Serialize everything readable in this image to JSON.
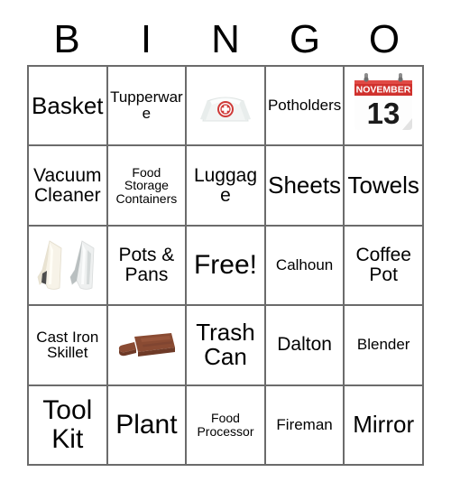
{
  "card": {
    "header_letters": [
      "B",
      "I",
      "N",
      "G",
      "O"
    ],
    "rows": [
      [
        {
          "type": "text",
          "label": "Basket",
          "size": "t-lg"
        },
        {
          "type": "text",
          "label": "Tupperware",
          "size": "t-sm"
        },
        {
          "type": "emoji",
          "label": "nurse-cap",
          "alt": "Nurse cap"
        },
        {
          "type": "text",
          "label": "Potholders",
          "size": "t-sm"
        },
        {
          "type": "emoji",
          "label": "calendar-november-13",
          "alt": "Calendar November 13",
          "calendar": {
            "month": "NOVEMBER",
            "day": "13",
            "header_color": "#d0312d",
            "day_color": "#1a1a1a"
          }
        }
      ],
      [
        {
          "type": "text",
          "label": "Vacuum Cleaner",
          "size": "t-md"
        },
        {
          "type": "text",
          "label": "Food Storage Containers",
          "size": "t-xs"
        },
        {
          "type": "text",
          "label": "Luggage",
          "size": "t-md"
        },
        {
          "type": "text",
          "label": "Sheets",
          "size": "t-lg"
        },
        {
          "type": "text",
          "label": "Towels",
          "size": "t-lg"
        }
      ],
      [
        {
          "type": "emoji",
          "label": "two-hanging-towels",
          "alt": "Two hanging towels"
        },
        {
          "type": "text",
          "label": "Pots & Pans",
          "size": "t-md"
        },
        {
          "type": "text",
          "label": "Free!",
          "size": "t-xl"
        },
        {
          "type": "text",
          "label": "Calhoun",
          "size": "t-sm"
        },
        {
          "type": "text",
          "label": "Coffee Pot",
          "size": "t-md"
        }
      ],
      [
        {
          "type": "text",
          "label": "Cast Iron Skillet",
          "size": "t-sm"
        },
        {
          "type": "emoji",
          "label": "wooden-cutting-board",
          "alt": "Wooden cutting board"
        },
        {
          "type": "text",
          "label": "Trash Can",
          "size": "t-lg"
        },
        {
          "type": "text",
          "label": "Dalton",
          "size": "t-md"
        },
        {
          "type": "text",
          "label": "Blender",
          "size": "t-sm"
        }
      ],
      [
        {
          "type": "text",
          "label": "Tool Kit",
          "size": "t-xl"
        },
        {
          "type": "text",
          "label": "Plant",
          "size": "t-xl"
        },
        {
          "type": "text",
          "label": "Food Processor",
          "size": "t-xs"
        },
        {
          "type": "text",
          "label": "Fireman",
          "size": "t-sm"
        },
        {
          "type": "text",
          "label": "Mirror",
          "size": "t-lg"
        }
      ]
    ],
    "colors": {
      "background": "#ffffff",
      "text": "#000000",
      "grid_line": "#6b6b6b",
      "calendar_red": "#d0312d",
      "nurse_cross_red": "#cf3a38"
    }
  }
}
